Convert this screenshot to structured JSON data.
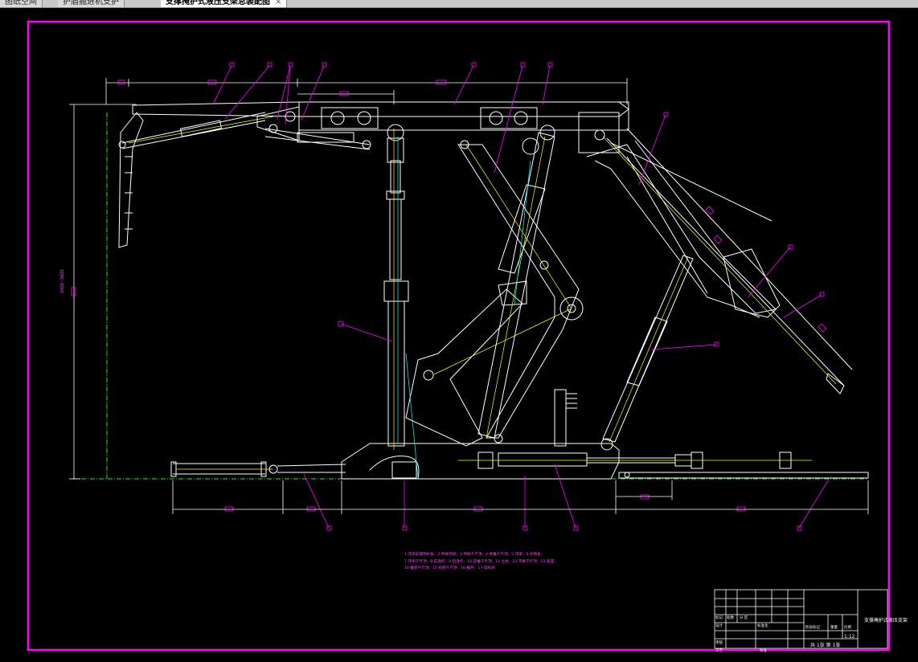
{
  "tabs": [
    {
      "label": "图纸空间"
    },
    {
      "label": "护盾掘进机支护"
    },
    {
      "label": "支撑掩护式液压支架总装配图"
    }
  ],
  "tab_close_glyph": "×",
  "drawing": {
    "vertical_dimension": "2000~3600",
    "scale_small": "0",
    "part_callouts": [
      "1",
      "2",
      "3",
      "4",
      "5",
      "6",
      "7",
      "8",
      "9",
      "10",
      "11",
      "12",
      "13",
      "14",
      "15",
      "16",
      "17",
      "18",
      "19",
      "20",
      "21"
    ],
    "legend_lines": [
      "1-顶梁前端侧护板；2-伸缩顶梁；3-伸缩千斤顶；4-侧推千斤顶；5-顶梁；6-护帮板；",
      "7-顶梁千斤顶；8-前连杆；9-后连杆；10-前推千斤顶；11-立柱；12-平衡千斤顶；13-底座；",
      "14-推移千斤顶；15-抬底千斤顶；16-推杆；17-操纵阀"
    ]
  },
  "title_block": {
    "drawing_title": "支撑掩护式液压支架",
    "scale": "1:12",
    "sheet_info": "共 1张   第 1张",
    "labels": {
      "mark": "标记",
      "count": "处数",
      "zone": "分 区",
      "design": "设计",
      "standard": "标准化",
      "stage": "阶段标记",
      "weight": "重量",
      "ratio": "比例",
      "review": "审核",
      "process": "工艺",
      "approve": "批准"
    }
  },
  "colors": {
    "frame": "#ff00ff",
    "geometry": "#ffffff",
    "centerline": "#ffff00",
    "dimension": "#ff00ff",
    "hidden": "#00ffff",
    "ground": "#00ff00",
    "background": "#000000"
  }
}
